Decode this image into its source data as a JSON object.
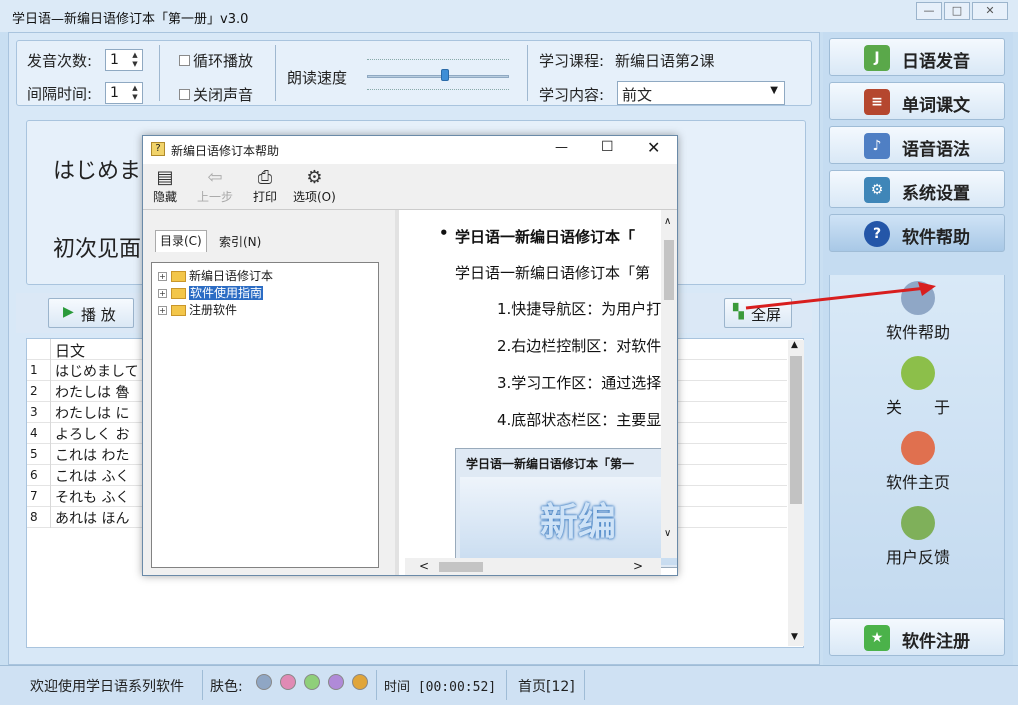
{
  "window": {
    "title": "学日语—新编日语修订本「第一册」v3.0",
    "min": "—",
    "max": "□",
    "close": "✕"
  },
  "settings": {
    "repeat_label": "发音次数:",
    "repeat_value": "1",
    "interval_label": "间隔时间:",
    "interval_value": "1",
    "loop_label": "循环播放",
    "mute_label": "关闭声音",
    "speed_label": "朗读速度",
    "speed_level": 0.55,
    "course_label": "学习课程:",
    "course_value": "新编日语第2课",
    "content_label": "学习内容:",
    "content_value": "前文"
  },
  "text_panel": {
    "line1": "はじめま",
    "line2": "初次见面"
  },
  "controls": {
    "play_label": "播 放",
    "fullscreen_label": "全屏"
  },
  "grid": {
    "header": "日文",
    "rows": [
      {
        "no": "1",
        "text": "はじめまして"
      },
      {
        "no": "2",
        "text": "わたしは 魯"
      },
      {
        "no": "3",
        "text": "わたしは に"
      },
      {
        "no": "4",
        "text": "よろしく お"
      },
      {
        "no": "5",
        "text": "これは わた"
      },
      {
        "no": "6",
        "text": "これは ふく"
      },
      {
        "no": "7",
        "text": "それも ふく"
      },
      {
        "no": "8",
        "text": "あれは ほん"
      }
    ]
  },
  "sidebar": {
    "buttons": [
      {
        "label": "日语发音",
        "icon": "J",
        "color": "#5aa84a"
      },
      {
        "label": "单词课文",
        "icon": "≡",
        "color": "#b5472f"
      },
      {
        "label": "语音语法",
        "icon": "♪",
        "color": "#4f7fc4"
      },
      {
        "label": "系统设置",
        "icon": "⚙",
        "color": "#3f86b8"
      },
      {
        "label": "软件帮助",
        "icon": "?",
        "color": "#2456a8"
      }
    ],
    "help_items": [
      {
        "label": "软件帮助",
        "icon": "help-book-icon",
        "color": "#8fa7c6"
      },
      {
        "label": "关　　于",
        "icon": "plant-icon",
        "color": "#8cbf4a"
      },
      {
        "label": "软件主页",
        "icon": "home-icon",
        "color": "#e0704f"
      },
      {
        "label": "用户反馈",
        "icon": "feedback-icon",
        "color": "#7fb05a"
      }
    ],
    "register_label": "软件注册"
  },
  "statusbar": {
    "welcome": "欢迎使用学日语系列软件",
    "skin_label": "肤色:",
    "skin_colors": [
      "#8fa6c4",
      "#e08ab4",
      "#8fcf7a",
      "#b08ad8",
      "#e0a53a"
    ],
    "time": "时间 [00:00:52]",
    "page": "首页[12]"
  },
  "dialog": {
    "title": "新编日语修订本帮助",
    "toolbar": {
      "hide": "隐藏",
      "back": "上一步",
      "print": "打印",
      "options": "选项(O)"
    },
    "tabs": {
      "contents": "目录(C)",
      "index": "索引(N)"
    },
    "tree": [
      {
        "label": "新编日语修订本"
      },
      {
        "label": "软件使用指南"
      },
      {
        "label": "注册软件"
      }
    ],
    "content": {
      "heading": "学日语一新编日语修订本「",
      "intro": "学日语一新编日语修订本「第",
      "items": [
        "1.快捷导航区：为用户打",
        "2.右边栏控制区：对软件",
        "3.学习工作区：通过选择",
        "4.底部状态栏区：主要显"
      ],
      "preview_title": "学日语一新编日语修订本「第一",
      "preview_big": "新编"
    }
  }
}
